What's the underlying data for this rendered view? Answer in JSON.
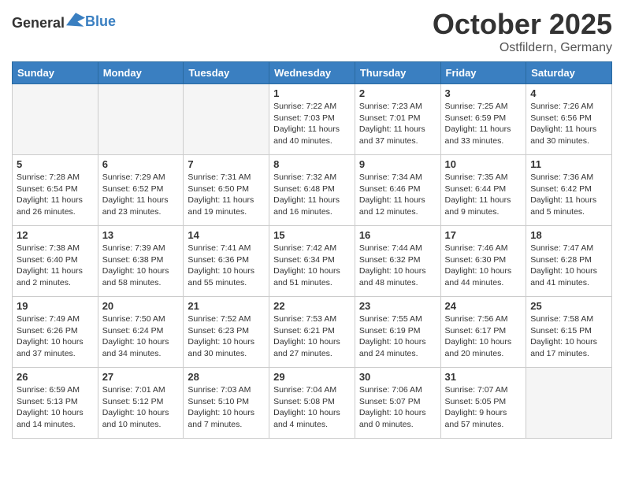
{
  "header": {
    "logo_general": "General",
    "logo_blue": "Blue",
    "month": "October 2025",
    "location": "Ostfildern, Germany"
  },
  "weekdays": [
    "Sunday",
    "Monday",
    "Tuesday",
    "Wednesday",
    "Thursday",
    "Friday",
    "Saturday"
  ],
  "weeks": [
    [
      {
        "day": "",
        "info": ""
      },
      {
        "day": "",
        "info": ""
      },
      {
        "day": "",
        "info": ""
      },
      {
        "day": "1",
        "info": "Sunrise: 7:22 AM\nSunset: 7:03 PM\nDaylight: 11 hours and 40 minutes."
      },
      {
        "day": "2",
        "info": "Sunrise: 7:23 AM\nSunset: 7:01 PM\nDaylight: 11 hours and 37 minutes."
      },
      {
        "day": "3",
        "info": "Sunrise: 7:25 AM\nSunset: 6:59 PM\nDaylight: 11 hours and 33 minutes."
      },
      {
        "day": "4",
        "info": "Sunrise: 7:26 AM\nSunset: 6:56 PM\nDaylight: 11 hours and 30 minutes."
      }
    ],
    [
      {
        "day": "5",
        "info": "Sunrise: 7:28 AM\nSunset: 6:54 PM\nDaylight: 11 hours and 26 minutes."
      },
      {
        "day": "6",
        "info": "Sunrise: 7:29 AM\nSunset: 6:52 PM\nDaylight: 11 hours and 23 minutes."
      },
      {
        "day": "7",
        "info": "Sunrise: 7:31 AM\nSunset: 6:50 PM\nDaylight: 11 hours and 19 minutes."
      },
      {
        "day": "8",
        "info": "Sunrise: 7:32 AM\nSunset: 6:48 PM\nDaylight: 11 hours and 16 minutes."
      },
      {
        "day": "9",
        "info": "Sunrise: 7:34 AM\nSunset: 6:46 PM\nDaylight: 11 hours and 12 minutes."
      },
      {
        "day": "10",
        "info": "Sunrise: 7:35 AM\nSunset: 6:44 PM\nDaylight: 11 hours and 9 minutes."
      },
      {
        "day": "11",
        "info": "Sunrise: 7:36 AM\nSunset: 6:42 PM\nDaylight: 11 hours and 5 minutes."
      }
    ],
    [
      {
        "day": "12",
        "info": "Sunrise: 7:38 AM\nSunset: 6:40 PM\nDaylight: 11 hours and 2 minutes."
      },
      {
        "day": "13",
        "info": "Sunrise: 7:39 AM\nSunset: 6:38 PM\nDaylight: 10 hours and 58 minutes."
      },
      {
        "day": "14",
        "info": "Sunrise: 7:41 AM\nSunset: 6:36 PM\nDaylight: 10 hours and 55 minutes."
      },
      {
        "day": "15",
        "info": "Sunrise: 7:42 AM\nSunset: 6:34 PM\nDaylight: 10 hours and 51 minutes."
      },
      {
        "day": "16",
        "info": "Sunrise: 7:44 AM\nSunset: 6:32 PM\nDaylight: 10 hours and 48 minutes."
      },
      {
        "day": "17",
        "info": "Sunrise: 7:46 AM\nSunset: 6:30 PM\nDaylight: 10 hours and 44 minutes."
      },
      {
        "day": "18",
        "info": "Sunrise: 7:47 AM\nSunset: 6:28 PM\nDaylight: 10 hours and 41 minutes."
      }
    ],
    [
      {
        "day": "19",
        "info": "Sunrise: 7:49 AM\nSunset: 6:26 PM\nDaylight: 10 hours and 37 minutes."
      },
      {
        "day": "20",
        "info": "Sunrise: 7:50 AM\nSunset: 6:24 PM\nDaylight: 10 hours and 34 minutes."
      },
      {
        "day": "21",
        "info": "Sunrise: 7:52 AM\nSunset: 6:23 PM\nDaylight: 10 hours and 30 minutes."
      },
      {
        "day": "22",
        "info": "Sunrise: 7:53 AM\nSunset: 6:21 PM\nDaylight: 10 hours and 27 minutes."
      },
      {
        "day": "23",
        "info": "Sunrise: 7:55 AM\nSunset: 6:19 PM\nDaylight: 10 hours and 24 minutes."
      },
      {
        "day": "24",
        "info": "Sunrise: 7:56 AM\nSunset: 6:17 PM\nDaylight: 10 hours and 20 minutes."
      },
      {
        "day": "25",
        "info": "Sunrise: 7:58 AM\nSunset: 6:15 PM\nDaylight: 10 hours and 17 minutes."
      }
    ],
    [
      {
        "day": "26",
        "info": "Sunrise: 6:59 AM\nSunset: 5:13 PM\nDaylight: 10 hours and 14 minutes."
      },
      {
        "day": "27",
        "info": "Sunrise: 7:01 AM\nSunset: 5:12 PM\nDaylight: 10 hours and 10 minutes."
      },
      {
        "day": "28",
        "info": "Sunrise: 7:03 AM\nSunset: 5:10 PM\nDaylight: 10 hours and 7 minutes."
      },
      {
        "day": "29",
        "info": "Sunrise: 7:04 AM\nSunset: 5:08 PM\nDaylight: 10 hours and 4 minutes."
      },
      {
        "day": "30",
        "info": "Sunrise: 7:06 AM\nSunset: 5:07 PM\nDaylight: 10 hours and 0 minutes."
      },
      {
        "day": "31",
        "info": "Sunrise: 7:07 AM\nSunset: 5:05 PM\nDaylight: 9 hours and 57 minutes."
      },
      {
        "day": "",
        "info": ""
      }
    ]
  ]
}
